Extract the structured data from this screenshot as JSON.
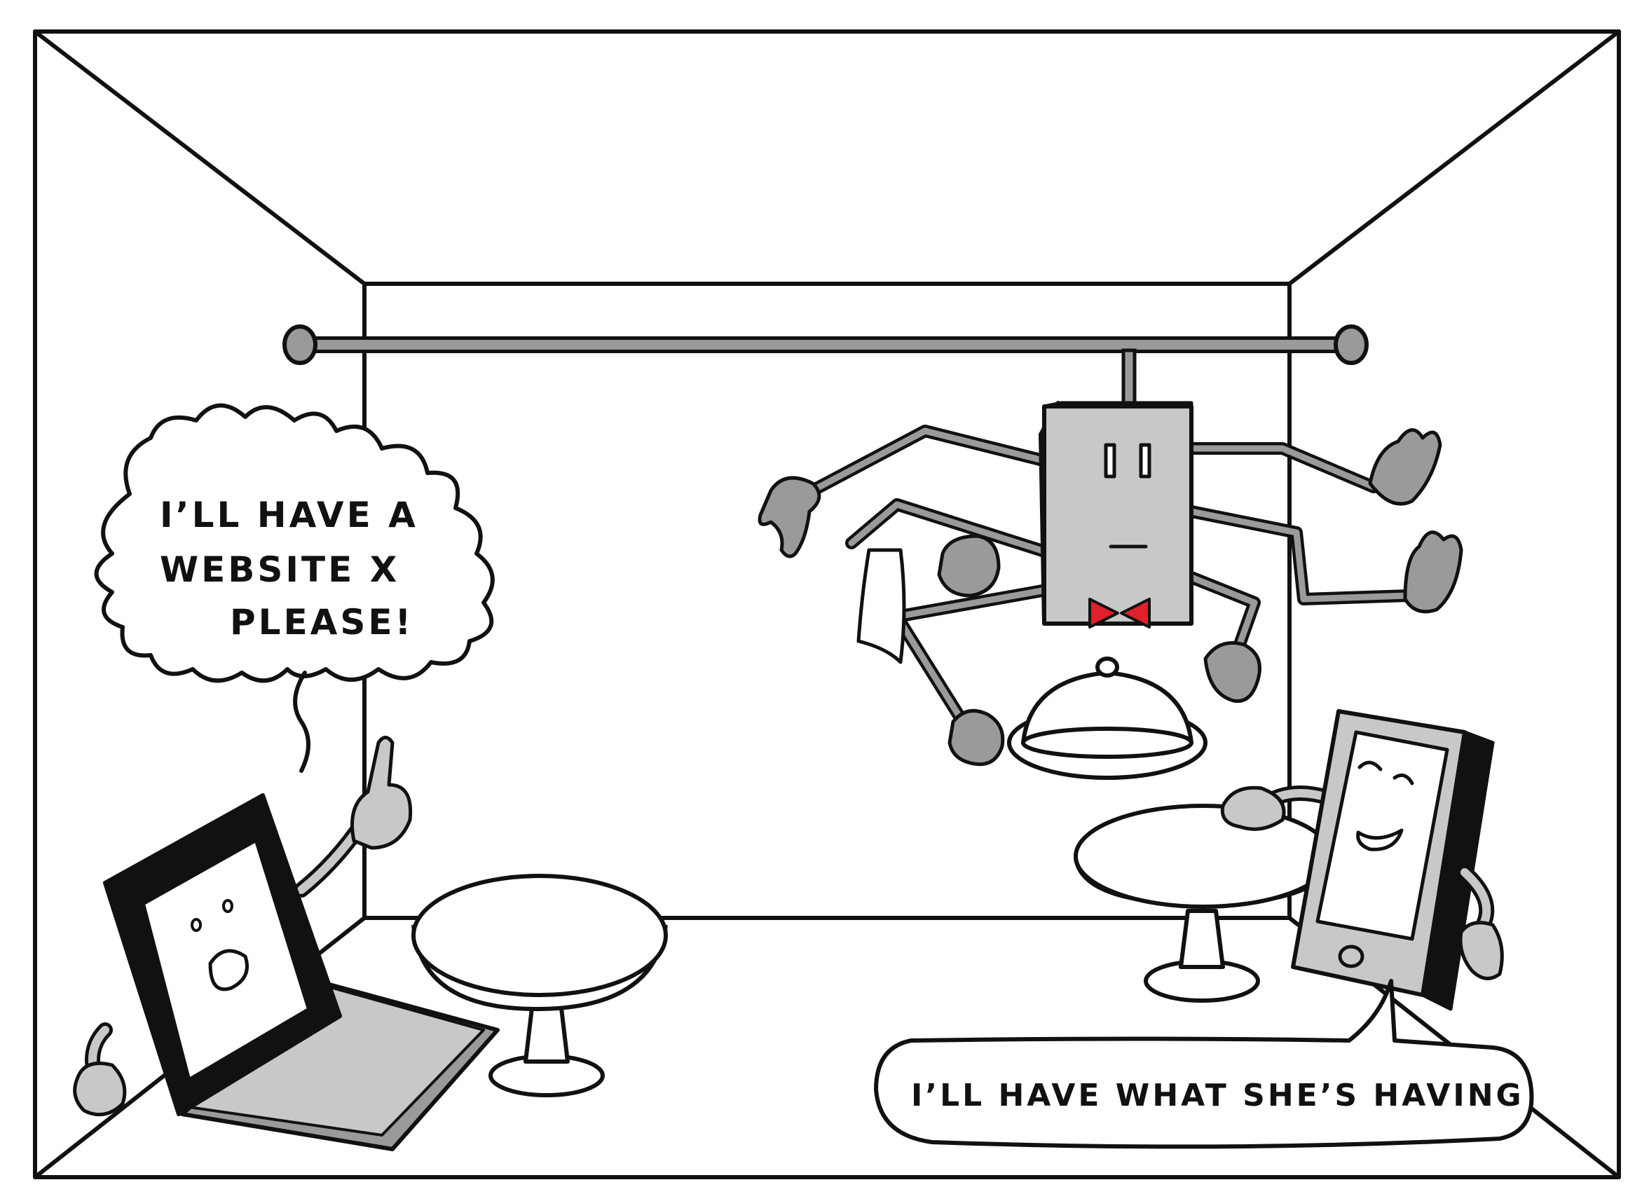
{
  "speech": {
    "laptop_line_1": "I’LL HAVE A",
    "laptop_line_2": "WEBSITE X",
    "laptop_line_3": "PLEASE!",
    "phone_line": "I’LL HAVE WHAT SHE’S HAVING"
  },
  "colors": {
    "ink": "#111111",
    "device_gray": "#c8c8c8",
    "dark_gray": "#9a9a9a",
    "bowtie": "#e0202a",
    "paper": "#ffffff"
  },
  "characters": {
    "laptop": "laptop-character",
    "server": "server-waiter-character",
    "phone": "smartphone-character"
  }
}
